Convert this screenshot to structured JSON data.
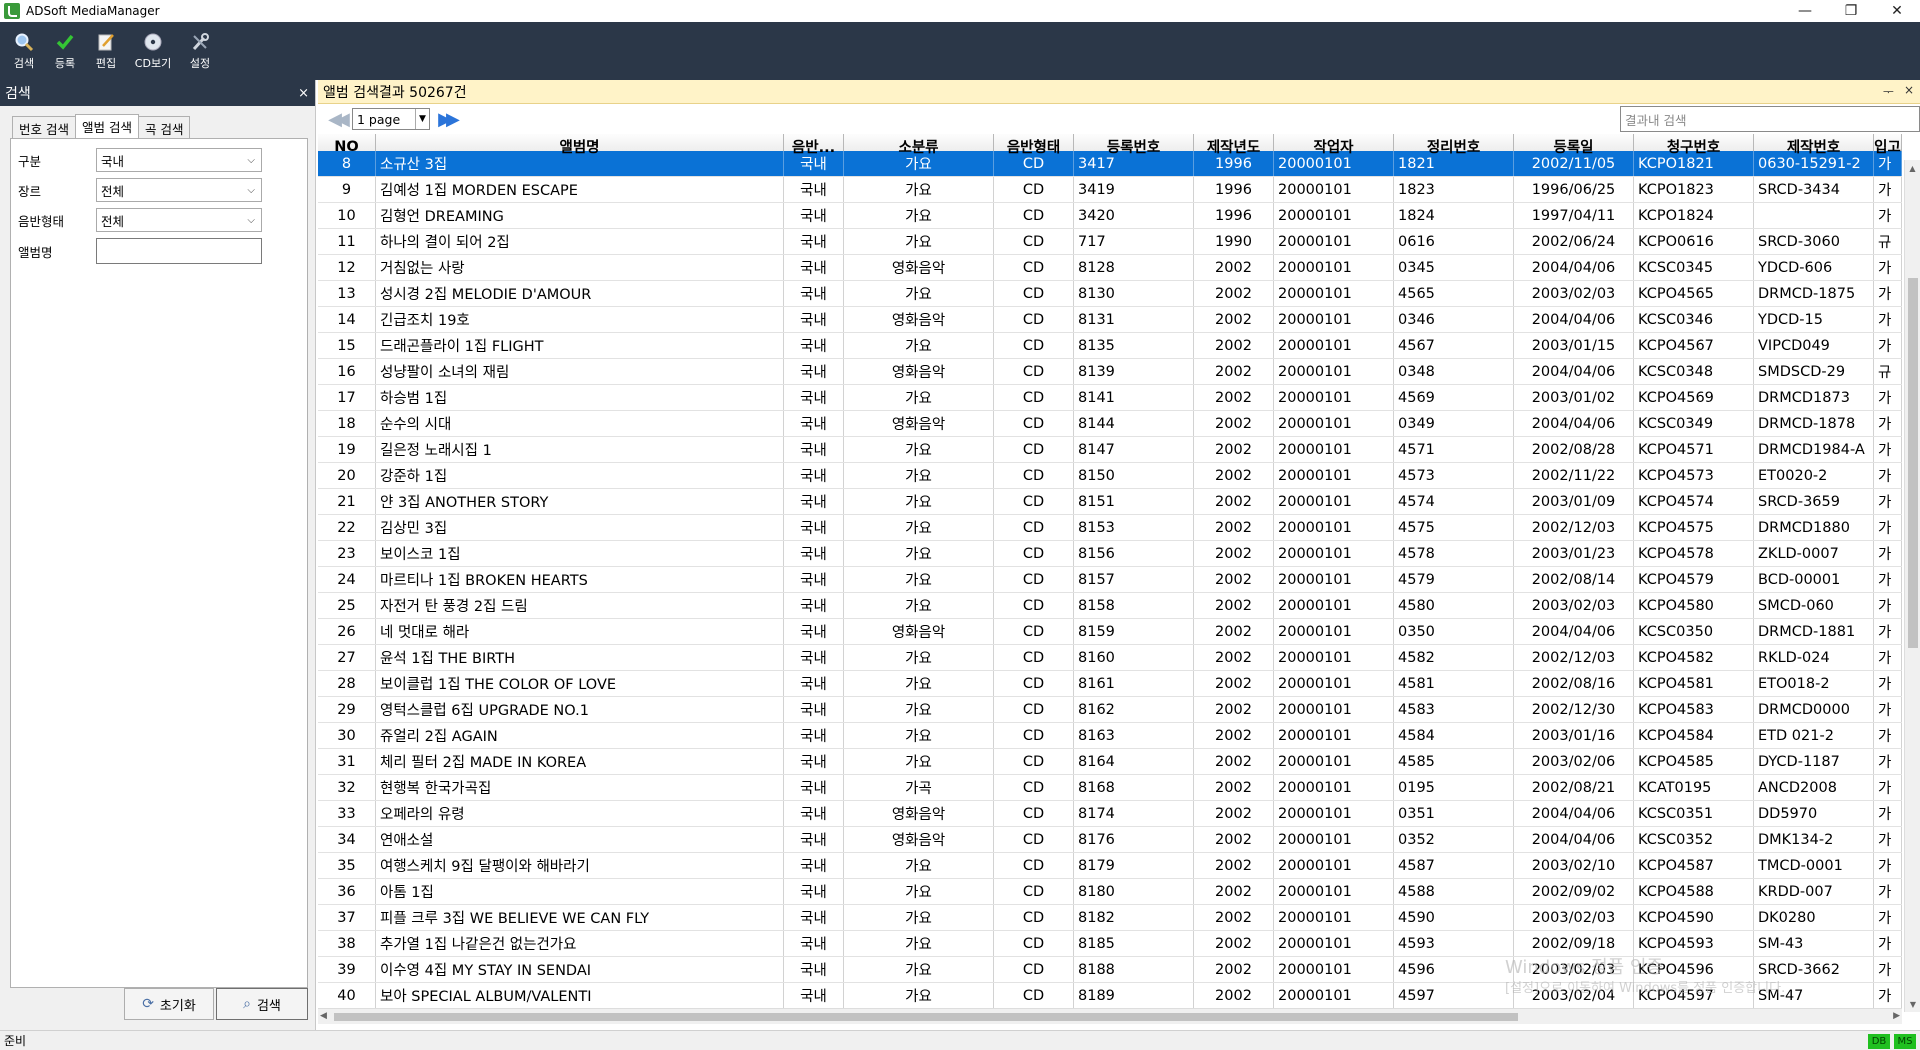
{
  "window": {
    "title": "ADSoft MediaManager",
    "minimize": "—",
    "restore": "❐",
    "close": "✕"
  },
  "toolbar": {
    "items": [
      {
        "label": "검색",
        "icon": "search-icon"
      },
      {
        "label": "등록",
        "icon": "check-icon"
      },
      {
        "label": "편집",
        "icon": "edit-icon"
      },
      {
        "label": "CD보기",
        "icon": "cd-icon"
      },
      {
        "label": "설정",
        "icon": "tools-icon"
      }
    ]
  },
  "left_panel": {
    "title": "검색",
    "close": "×",
    "tabs": [
      "번호 검색",
      "앨범 검색",
      "곡 검색"
    ],
    "active_tab": 1,
    "fields": {
      "category": {
        "label": "구분",
        "value": "국내"
      },
      "genre": {
        "label": "장르",
        "value": "전체"
      },
      "media_type": {
        "label": "음반형태",
        "value": "전체"
      },
      "album_name": {
        "label": "앨범명",
        "value": ""
      }
    },
    "reset_button": "초기화",
    "search_button": "검색"
  },
  "main_panel": {
    "title": "앨범 검색결과 50267건",
    "controls": {
      "pin": "ᅮ",
      "close": "×"
    },
    "pager": {
      "page": "1 page"
    },
    "result_search_placeholder": "결과내 검색",
    "columns": [
      "NO",
      "앨범명",
      "음반...",
      "소분류",
      "음반형태",
      "등록번호",
      "제작년도",
      "작업자",
      "정리번호",
      "등록일",
      "청구번호",
      "제작번호",
      "입고"
    ],
    "rows": [
      [
        "8",
        "소규산 3집",
        "국내",
        "가요",
        "CD",
        "3417",
        "1996",
        "20000101",
        "1821",
        "2002/11/05",
        "KCPO1821",
        "0630-15291-2",
        "가"
      ],
      [
        "9",
        "김예성 1집 MORDEN ESCAPE",
        "국내",
        "가요",
        "CD",
        "3419",
        "1996",
        "20000101",
        "1823",
        "1996/06/25",
        "KCPO1823",
        "SRCD-3434",
        "가"
      ],
      [
        "10",
        "김형언 DREAMING",
        "국내",
        "가요",
        "CD",
        "3420",
        "1996",
        "20000101",
        "1824",
        "1997/04/11",
        "KCPO1824",
        "",
        "가"
      ],
      [
        "11",
        "하나의 결이 되어 2집",
        "국내",
        "가요",
        "CD",
        "717",
        "1990",
        "20000101",
        "0616",
        "2002/06/24",
        "KCPO0616",
        "SRCD-3060",
        "규"
      ],
      [
        "12",
        "거침없는 사랑",
        "국내",
        "영화음악",
        "CD",
        "8128",
        "2002",
        "20000101",
        "0345",
        "2004/04/06",
        "KCSC0345",
        "YDCD-606",
        "가"
      ],
      [
        "13",
        "성시경 2집 MELODIE D'AMOUR",
        "국내",
        "가요",
        "CD",
        "8130",
        "2002",
        "20000101",
        "4565",
        "2003/02/03",
        "KCPO4565",
        "DRMCD-1875",
        "가"
      ],
      [
        "14",
        "긴급조치 19호",
        "국내",
        "영화음악",
        "CD",
        "8131",
        "2002",
        "20000101",
        "0346",
        "2004/04/06",
        "KCSC0346",
        "YDCD-15",
        "가"
      ],
      [
        "15",
        "드래곤플라이 1집 FLIGHT",
        "국내",
        "가요",
        "CD",
        "8135",
        "2002",
        "20000101",
        "4567",
        "2003/01/15",
        "KCPO4567",
        "VIPCD049",
        "가"
      ],
      [
        "16",
        "성냥팔이 소녀의 재림",
        "국내",
        "영화음악",
        "CD",
        "8139",
        "2002",
        "20000101",
        "0348",
        "2004/04/06",
        "KCSC0348",
        "SMDSCD-29",
        "규"
      ],
      [
        "17",
        "하승범 1집",
        "국내",
        "가요",
        "CD",
        "8141",
        "2002",
        "20000101",
        "4569",
        "2003/01/02",
        "KCPO4569",
        "DRMCD1873",
        "가"
      ],
      [
        "18",
        "순수의 시대",
        "국내",
        "영화음악",
        "CD",
        "8144",
        "2002",
        "20000101",
        "0349",
        "2004/04/06",
        "KCSC0349",
        "DRMCD-1878",
        "가"
      ],
      [
        "19",
        "길은정 노래시집 1",
        "국내",
        "가요",
        "CD",
        "8147",
        "2002",
        "20000101",
        "4571",
        "2002/08/28",
        "KCPO4571",
        "DRMCD1984-A",
        "가"
      ],
      [
        "20",
        "강준하 1집",
        "국내",
        "가요",
        "CD",
        "8150",
        "2002",
        "20000101",
        "4573",
        "2002/11/22",
        "KCPO4573",
        "ET0020-2",
        "가"
      ],
      [
        "21",
        "얀 3집 ANOTHER STORY",
        "국내",
        "가요",
        "CD",
        "8151",
        "2002",
        "20000101",
        "4574",
        "2003/01/09",
        "KCPO4574",
        "SRCD-3659",
        "가"
      ],
      [
        "22",
        "김상민 3집",
        "국내",
        "가요",
        "CD",
        "8153",
        "2002",
        "20000101",
        "4575",
        "2002/12/03",
        "KCPO4575",
        "DRMCD1880",
        "가"
      ],
      [
        "23",
        "보이스코 1집",
        "국내",
        "가요",
        "CD",
        "8156",
        "2002",
        "20000101",
        "4578",
        "2003/01/23",
        "KCPO4578",
        "ZKLD-0007",
        "가"
      ],
      [
        "24",
        "마르티나 1집 BROKEN HEARTS",
        "국내",
        "가요",
        "CD",
        "8157",
        "2002",
        "20000101",
        "4579",
        "2002/08/14",
        "KCPO4579",
        "BCD-00001",
        "가"
      ],
      [
        "25",
        "자전거 탄 풍경 2집 드림",
        "국내",
        "가요",
        "CD",
        "8158",
        "2002",
        "20000101",
        "4580",
        "2003/02/03",
        "KCPO4580",
        "SMCD-060",
        "가"
      ],
      [
        "26",
        "네 멋대로 해라",
        "국내",
        "영화음악",
        "CD",
        "8159",
        "2002",
        "20000101",
        "0350",
        "2004/04/06",
        "KCSC0350",
        "DRMCD-1881",
        "가"
      ],
      [
        "27",
        "윤석 1집 THE BIRTH",
        "국내",
        "가요",
        "CD",
        "8160",
        "2002",
        "20000101",
        "4582",
        "2002/12/03",
        "KCPO4582",
        "RKLD-024",
        "가"
      ],
      [
        "28",
        "보이클럽 1집 THE COLOR OF LOVE",
        "국내",
        "가요",
        "CD",
        "8161",
        "2002",
        "20000101",
        "4581",
        "2002/08/16",
        "KCPO4581",
        "ETO018-2",
        "가"
      ],
      [
        "29",
        "영턱스클럽 6집 UPGRADE NO.1",
        "국내",
        "가요",
        "CD",
        "8162",
        "2002",
        "20000101",
        "4583",
        "2002/12/30",
        "KCPO4583",
        "DRMCD0000",
        "가"
      ],
      [
        "30",
        "쥬얼리 2집 AGAIN",
        "국내",
        "가요",
        "CD",
        "8163",
        "2002",
        "20000101",
        "4584",
        "2003/01/16",
        "KCPO4584",
        "ETD 021-2",
        "가"
      ],
      [
        "31",
        "체리 필터 2집 MADE IN KOREA",
        "국내",
        "가요",
        "CD",
        "8164",
        "2002",
        "20000101",
        "4585",
        "2003/02/06",
        "KCPO4585",
        "DYCD-1187",
        "가"
      ],
      [
        "32",
        "현행복 한국가곡집",
        "국내",
        "가곡",
        "CD",
        "8168",
        "2002",
        "20000101",
        "0195",
        "2002/08/21",
        "KCAT0195",
        "ANCD2008",
        "가"
      ],
      [
        "33",
        "오페라의 유령",
        "국내",
        "영화음악",
        "CD",
        "8174",
        "2002",
        "20000101",
        "0351",
        "2004/04/06",
        "KCSC0351",
        "DD5970",
        "가"
      ],
      [
        "34",
        "연애소설",
        "국내",
        "영화음악",
        "CD",
        "8176",
        "2002",
        "20000101",
        "0352",
        "2004/04/06",
        "KCSC0352",
        "DMK134-2",
        "가"
      ],
      [
        "35",
        "여행스케치 9집 달팽이와 해바라기",
        "국내",
        "가요",
        "CD",
        "8179",
        "2002",
        "20000101",
        "4587",
        "2003/02/10",
        "KCPO4587",
        "TMCD-0001",
        "가"
      ],
      [
        "36",
        "아톰 1집",
        "국내",
        "가요",
        "CD",
        "8180",
        "2002",
        "20000101",
        "4588",
        "2002/09/02",
        "KCPO4588",
        "KRDD-007",
        "가"
      ],
      [
        "37",
        "피플 크루 3집 WE BELIEVE WE CAN FLY",
        "국내",
        "가요",
        "CD",
        "8182",
        "2002",
        "20000101",
        "4590",
        "2003/02/03",
        "KCPO4590",
        "DK0280",
        "가"
      ],
      [
        "38",
        "추가열 1집 나같은건 없는건가요",
        "국내",
        "가요",
        "CD",
        "8185",
        "2002",
        "20000101",
        "4593",
        "2002/09/18",
        "KCPO4593",
        "SM-43",
        "가"
      ],
      [
        "39",
        "이수영 4집 MY STAY IN SENDAI",
        "국내",
        "가요",
        "CD",
        "8188",
        "2002",
        "20000101",
        "4596",
        "2003/02/03",
        "KCPO4596",
        "SRCD-3662",
        "가"
      ],
      [
        "40",
        "보아 SPECIAL ALBUM/VALENTI",
        "국내",
        "가요",
        "CD",
        "8189",
        "2002",
        "20000101",
        "4597",
        "2003/02/04",
        "KCPO4597",
        "SM-47",
        "가"
      ]
    ],
    "selected_row": 0
  },
  "watermark": {
    "line1": "Windows 정품 인증",
    "line2": "[설정]으로 이동하여 Windows를 정품 인증합니다."
  },
  "status": {
    "text": "준비",
    "badge_db": "DB",
    "badge_ms": "MS"
  },
  "colors": {
    "toolbar": "#2b3748",
    "header_bar": "#fff3c8",
    "selection": "#0a72d6",
    "status_badge": "#20c020"
  }
}
